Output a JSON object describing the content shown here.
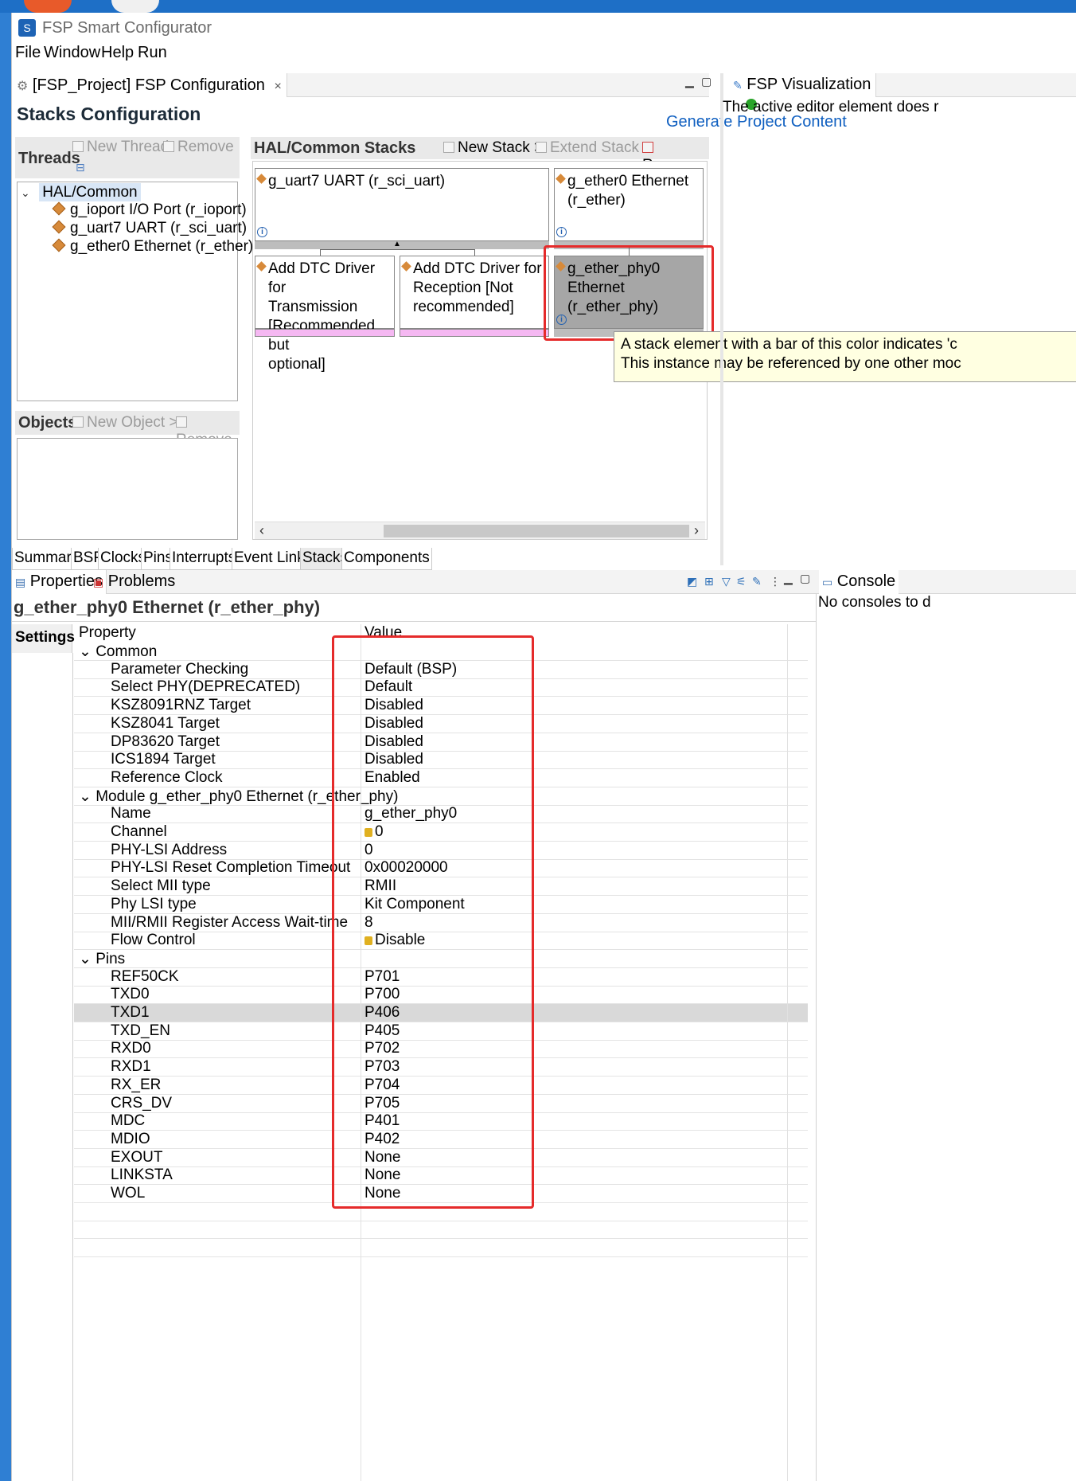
{
  "app": {
    "title": "FSP Smart Configurator"
  },
  "menu": [
    "File",
    "Window",
    "Help",
    "Run"
  ],
  "editor": {
    "tab_label": "[FSP_Project] FSP Configuration",
    "tab_close": "×",
    "page_title": "Stacks Configuration",
    "generate_label": "Generate Project Content"
  },
  "threads": {
    "title": "Threads",
    "new_thread": "New Thread",
    "remove": "Remove",
    "root": "HAL/Common",
    "items": [
      "g_ioport I/O Port (r_ioport)",
      "g_uart7 UART (r_sci_uart)",
      "g_ether0 Ethernet (r_ether)"
    ]
  },
  "objects": {
    "title": "Objects",
    "new_object": "New Object >",
    "remove": "Remove"
  },
  "stacks": {
    "title": "HAL/Common Stacks",
    "new_stack": "New Stack >",
    "extend_stack": "Extend Stack >",
    "remove": "Remove",
    "cards": {
      "uart": "g_uart7 UART (r_sci_uart)",
      "ether_l1": "g_ether0 Ethernet",
      "ether_l2": "(r_ether)",
      "dtc_tx_l1": "Add DTC Driver for",
      "dtc_tx_l2": "Transmission",
      "dtc_tx_l3": "[Recommended but",
      "dtc_tx_l4": "optional]",
      "dtc_rx_l1": "Add DTC Driver for",
      "dtc_rx_l2": "Reception [Not",
      "dtc_rx_l3": "recommended]",
      "phy_l1": "g_ether_phy0",
      "phy_l2": "Ethernet",
      "phy_l3": "(r_ether_phy)"
    },
    "tooltip_l1": "A stack element with a bar of this color indicates 'c",
    "tooltip_l2": "This instance may be referenced by one other moc"
  },
  "editor_tabs": [
    "Summary",
    "BSP",
    "Clocks",
    "Pins",
    "Interrupts",
    "Event Links",
    "Stacks",
    "Components"
  ],
  "visualization": {
    "title": "FSP Visualization",
    "message": "The active editor element does r"
  },
  "properties": {
    "tab_properties": "Properties",
    "tab_problems": "Problems",
    "title": "g_ether_phy0 Ethernet (r_ether_phy)",
    "settings_tab": "Settings",
    "col_property": "Property",
    "col_value": "Value",
    "rows": [
      {
        "k": "Common",
        "v": ""
      },
      {
        "k": "Parameter Checking",
        "v": "Default (BSP)"
      },
      {
        "k": "Select PHY(DEPRECATED)",
        "v": "Default"
      },
      {
        "k": "KSZ8091RNZ Target",
        "v": "Disabled"
      },
      {
        "k": "KSZ8041 Target",
        "v": "Disabled"
      },
      {
        "k": "DP83620 Target",
        "v": "Disabled"
      },
      {
        "k": "ICS1894 Target",
        "v": "Disabled"
      },
      {
        "k": "Reference Clock",
        "v": "Enabled"
      },
      {
        "k": "Module g_ether_phy0 Ethernet (r_ether_phy)",
        "v": ""
      },
      {
        "k": "Name",
        "v": "g_ether_phy0"
      },
      {
        "k": "Channel",
        "v": "0"
      },
      {
        "k": "PHY-LSI Address",
        "v": "0"
      },
      {
        "k": "PHY-LSI Reset Completion Timeout",
        "v": "0x00020000"
      },
      {
        "k": "Select MII type",
        "v": "RMII"
      },
      {
        "k": "Phy LSI type",
        "v": "Kit Component"
      },
      {
        "k": "MII/RMII Register Access Wait-time",
        "v": "8"
      },
      {
        "k": "Flow Control",
        "v": "Disable"
      },
      {
        "k": "Pins",
        "v": ""
      },
      {
        "k": "REF50CK",
        "v": "P701"
      },
      {
        "k": "TXD0",
        "v": "P700"
      },
      {
        "k": "TXD1",
        "v": "P406"
      },
      {
        "k": "TXD_EN",
        "v": "P405"
      },
      {
        "k": "RXD0",
        "v": "P702"
      },
      {
        "k": "RXD1",
        "v": "P703"
      },
      {
        "k": "RX_ER",
        "v": "P704"
      },
      {
        "k": "CRS_DV",
        "v": "P705"
      },
      {
        "k": "MDC",
        "v": "P401"
      },
      {
        "k": "MDIO",
        "v": "P402"
      },
      {
        "k": "EXOUT",
        "v": "None"
      },
      {
        "k": "LINKSTA",
        "v": "None"
      },
      {
        "k": "WOL",
        "v": "None"
      }
    ]
  },
  "console": {
    "title": "Console",
    "message": "No consoles to d"
  },
  "colors": {
    "accent_link": "#0f5fc0",
    "highlight_red": "#e52b2b",
    "pink_bar": "#f5b8f2",
    "selected_card": "#a6a6a6",
    "tooltip_bg": "#ffffe1"
  }
}
